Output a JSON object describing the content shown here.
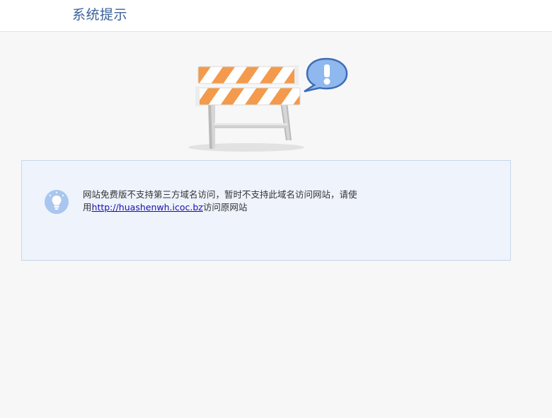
{
  "header": {
    "title": "系统提示"
  },
  "notice": {
    "icon": "lightbulb-icon",
    "message_line1": "网站免费版不支持第三方域名访问，暂时不支持此域名访问网站，请使",
    "message_prefix": "用",
    "link_text": "http://huashenwh.icoc.bz",
    "message_suffix": "访问原网站"
  },
  "hero": {
    "icons": [
      "road-barrier-icon",
      "warning-speech-bubble-icon"
    ]
  },
  "colors": {
    "title": "#3a5f9a",
    "notice_bg": "#eef3fc",
    "notice_border": "#c8d6ea",
    "link": "#1a0dab",
    "barrier_orange": "#f39a4c",
    "bubble_blue": "#5b8fd6"
  }
}
